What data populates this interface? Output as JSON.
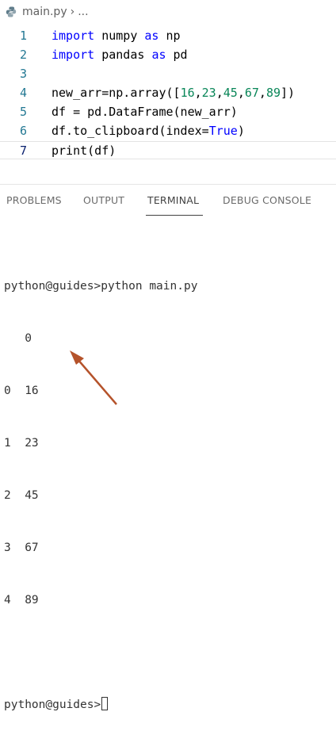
{
  "breadcrumb": {
    "file": "main.py",
    "more": "..."
  },
  "editor": {
    "lines": [
      {
        "n": "1",
        "text": "import numpy as np"
      },
      {
        "n": "2",
        "text": "import pandas as pd"
      },
      {
        "n": "3",
        "text": ""
      },
      {
        "n": "4",
        "text": "new_arr=np.array([16,23,45,67,89])"
      },
      {
        "n": "5",
        "text": "df = pd.DataFrame(new_arr)"
      },
      {
        "n": "6",
        "text": "df.to_clipboard(index=True)"
      },
      {
        "n": "7",
        "text": "print(df)"
      }
    ]
  },
  "panel": {
    "tabs": [
      "PROBLEMS",
      "OUTPUT",
      "TERMINAL",
      "DEBUG CONSOLE"
    ],
    "active_tab": "TERMINAL"
  },
  "terminal": {
    "command_line": "python@guides>python main.py",
    "output": [
      "   0",
      "0  16",
      "1  23",
      "2  45",
      "3  67",
      "4  89"
    ],
    "prompt": "python@guides>"
  },
  "colors": {
    "keyword": "#0000ff",
    "number": "#098658",
    "line_number": "#237893",
    "arrow": "#b5532b"
  }
}
